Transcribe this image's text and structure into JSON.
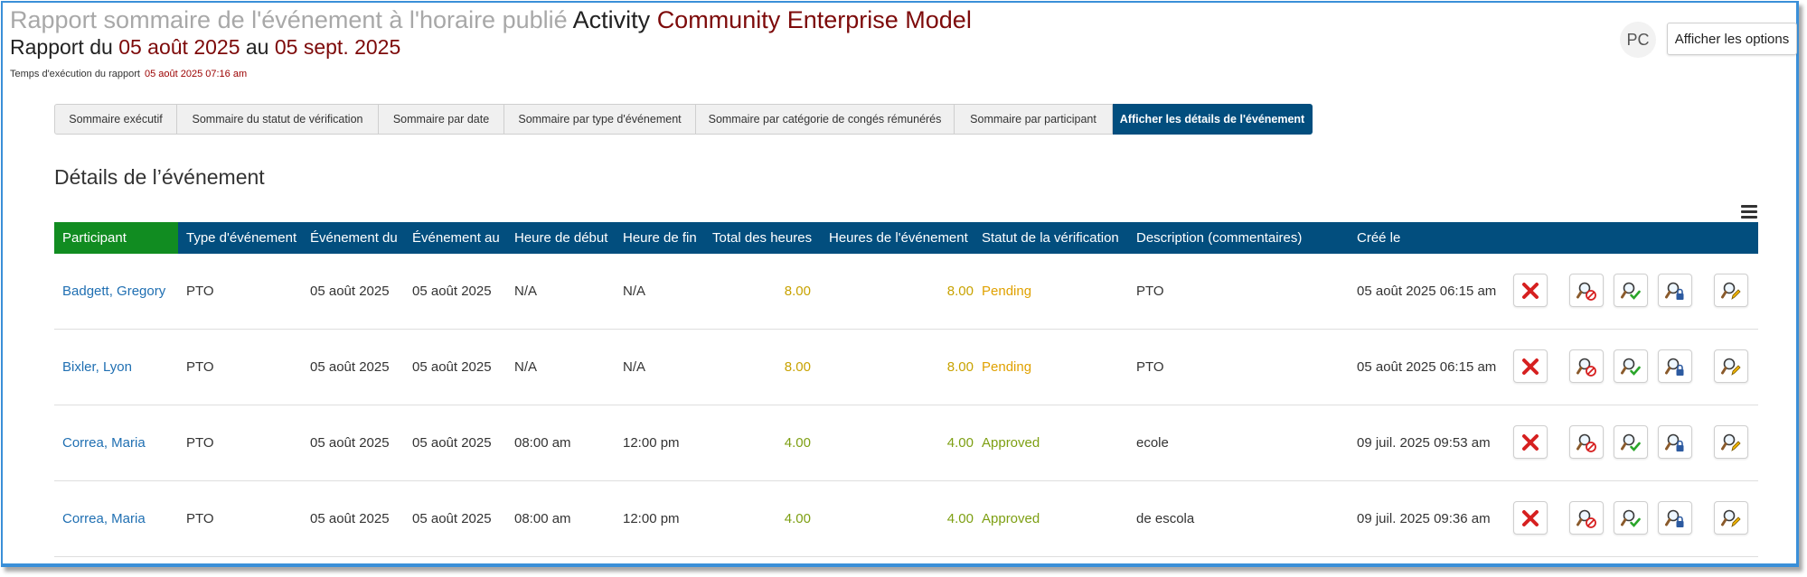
{
  "header": {
    "title_prefix": "Rapport sommaire de l'événement à l'horaire publié",
    "title_activity": "Activity",
    "title_org": "Community Enterprise Model",
    "report_label": "Rapport du",
    "date_from": "05 août 2025",
    "to_label": "au",
    "date_to": "05 sept. 2025",
    "runtime_label": "Temps d'exécution du rapport",
    "runtime_value": "05 août 2025 07:16 am"
  },
  "user": {
    "initials": "PC"
  },
  "options_button": "Afficher les options",
  "tabs": [
    {
      "label": "Sommaire exécutif"
    },
    {
      "label": "Sommaire du statut de vérification"
    },
    {
      "label": "Sommaire par date"
    },
    {
      "label": "Sommaire par type d'événement"
    },
    {
      "label": "Sommaire par catégorie de congés rémunérés"
    },
    {
      "label": "Sommaire par participant"
    },
    {
      "label": "Afficher les détails de l'événement",
      "active": true
    }
  ],
  "section_title": "Détails de l’événement",
  "table": {
    "columns": [
      "Participant",
      "Type d'événement",
      "Événement du",
      "Événement au",
      "Heure de début",
      "Heure de fin",
      "Total des heures",
      "Heures de l'événement",
      "Statut de la vérification",
      "Description (commentaires)",
      "Créé le"
    ],
    "rows": [
      {
        "participant": "Badgett, Gregory",
        "type": "PTO",
        "from": "05 août 2025",
        "to": "05 août 2025",
        "start": "N/A",
        "end": "N/A",
        "total": "8.00",
        "event_hours": "8.00",
        "status": "Pending",
        "description": "PTO",
        "created": "05 août 2025 06:15 am"
      },
      {
        "participant": "Bixler, Lyon",
        "type": "PTO",
        "from": "05 août 2025",
        "to": "05 août 2025",
        "start": "N/A",
        "end": "N/A",
        "total": "8.00",
        "event_hours": "8.00",
        "status": "Pending",
        "description": "PTO",
        "created": "05 août 2025 06:15 am"
      },
      {
        "participant": "Correa, Maria",
        "type": "PTO",
        "from": "05 août 2025",
        "to": "05 août 2025",
        "start": "08:00 am",
        "end": "12:00 pm",
        "total": "4.00",
        "event_hours": "4.00",
        "status": "Approved",
        "description": "ecole",
        "created": "09 juil. 2025 09:53 am"
      },
      {
        "participant": "Correa, Maria",
        "type": "PTO",
        "from": "05 août 2025",
        "to": "05 août 2025",
        "start": "08:00 am",
        "end": "12:00 pm",
        "total": "4.00",
        "event_hours": "4.00",
        "status": "Approved",
        "description": "de escola",
        "created": "09 juil. 2025 09:36 am"
      }
    ]
  },
  "icons": {
    "delete": "x-icon",
    "reject": "magnifier-reject-icon",
    "approve": "magnifier-approve-icon",
    "lock": "magnifier-lock-icon",
    "edit": "magnifier-edit-icon"
  },
  "colors": {
    "header_blue": "#024e7e",
    "participant_green": "#118c21",
    "accent_red": "#7d0a0a",
    "pending": "#e0a100",
    "approved": "#7d9f12",
    "link": "#1f6fb2"
  }
}
